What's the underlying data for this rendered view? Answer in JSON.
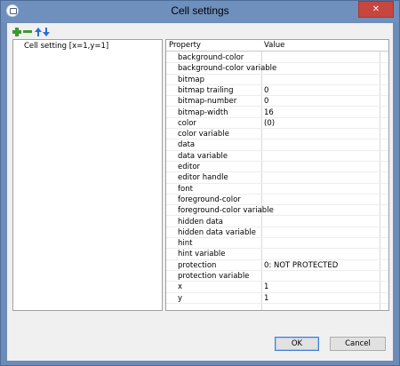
{
  "window": {
    "title": "Cell settings",
    "close_glyph": "✕"
  },
  "toolbar": {
    "icons": [
      "plus-icon",
      "minus-icon",
      "up-arrow-icon",
      "down-arrow-icon"
    ]
  },
  "tree": {
    "items": [
      {
        "label": "Cell setting [x=1,y=1]"
      }
    ]
  },
  "grid": {
    "columns": [
      "Property",
      "Value"
    ],
    "rows": [
      {
        "property": "background-color",
        "value": ""
      },
      {
        "property": "background-color variable",
        "value": ""
      },
      {
        "property": "bitmap",
        "value": ""
      },
      {
        "property": "bitmap trailing",
        "value": "0"
      },
      {
        "property": "bitmap-number",
        "value": "0"
      },
      {
        "property": "bitmap-width",
        "value": "16"
      },
      {
        "property": "color",
        "value": "(0)"
      },
      {
        "property": "color variable",
        "value": ""
      },
      {
        "property": "data",
        "value": ""
      },
      {
        "property": "data variable",
        "value": ""
      },
      {
        "property": "editor",
        "value": ""
      },
      {
        "property": "editor handle",
        "value": ""
      },
      {
        "property": "font",
        "value": ""
      },
      {
        "property": "foreground-color",
        "value": ""
      },
      {
        "property": "foreground-color variable",
        "value": ""
      },
      {
        "property": "hidden data",
        "value": ""
      },
      {
        "property": "hidden data variable",
        "value": ""
      },
      {
        "property": "hint",
        "value": ""
      },
      {
        "property": "hint variable",
        "value": ""
      },
      {
        "property": "protection",
        "value": "0: NOT PROTECTED"
      },
      {
        "property": "protection variable",
        "value": ""
      },
      {
        "property": "x",
        "value": "1"
      },
      {
        "property": "y",
        "value": "1"
      }
    ]
  },
  "buttons": {
    "ok": "OK",
    "cancel": "Cancel"
  },
  "colors": {
    "titlebar": "#6f8fbd",
    "close": "#c7463d",
    "client": "#f0f0f0",
    "accent": "#3c7fd1"
  }
}
